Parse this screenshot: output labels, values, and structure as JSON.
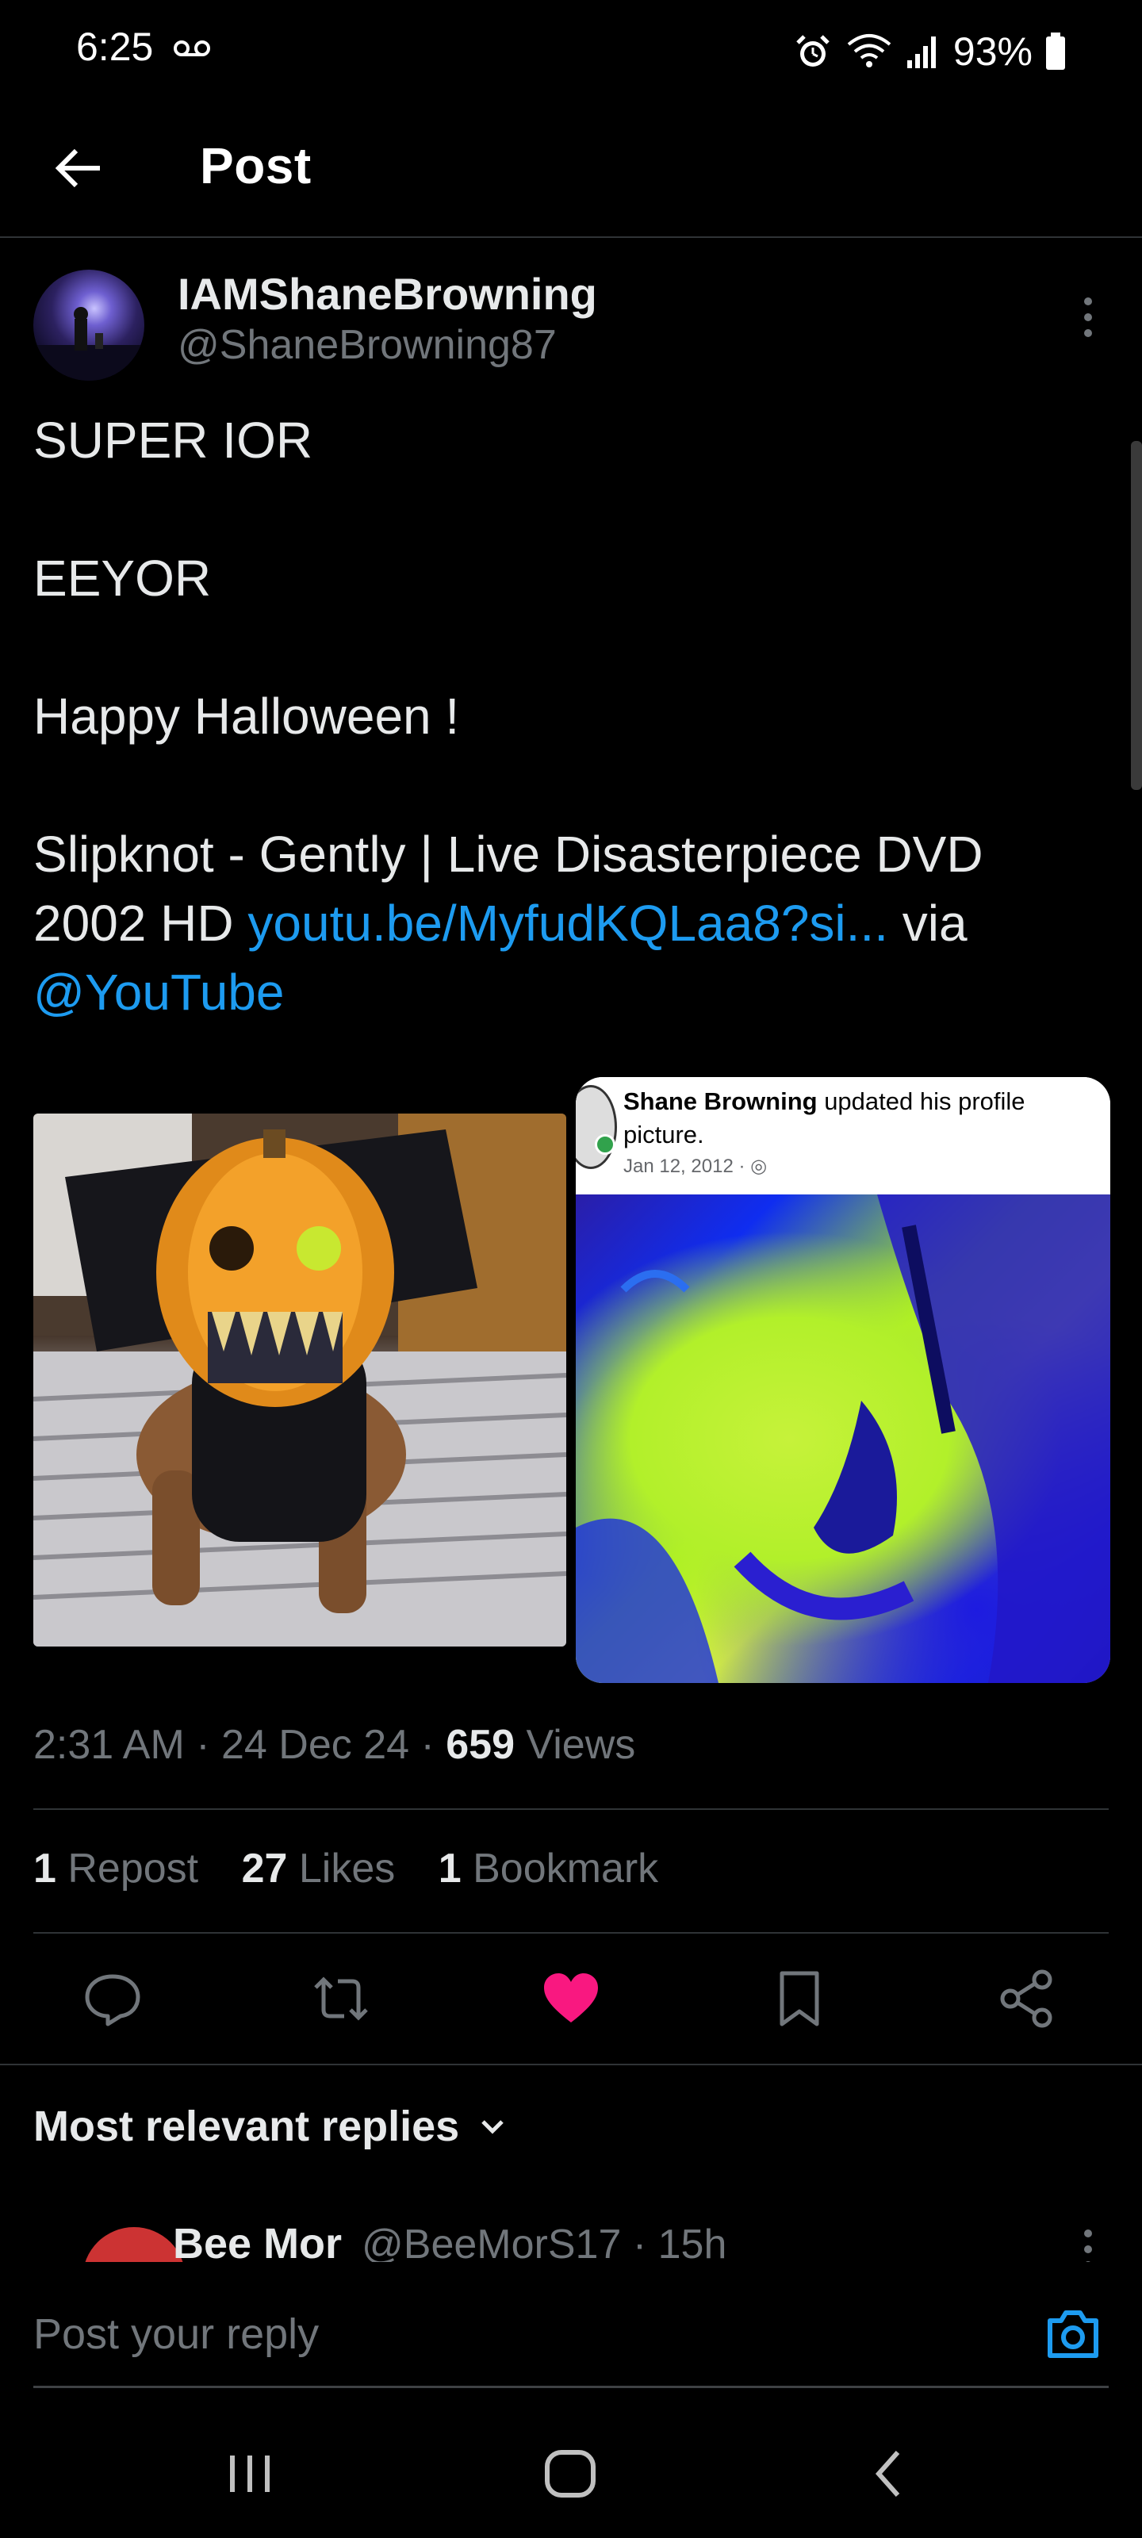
{
  "status_bar": {
    "time": "6:25",
    "battery": "93%"
  },
  "header": {
    "title": "Post"
  },
  "post": {
    "display_name": "IAMShaneBrowning",
    "handle": "@ShaneBrowning87",
    "lines": [
      "SUPER IOR",
      "EEYOR",
      "Happy Halloween !",
      "Slipknot - Gently | Live Disasterpiece DVD 2002 HD "
    ],
    "link_text": "youtu.be/MyfudKQLaa8?si...",
    "via_text": " via ",
    "mention": "@YouTube",
    "media2": {
      "name": "Shane Browning",
      "action": " updated his profile picture.",
      "date": "Jan 12, 2012 · "
    },
    "meta": {
      "time": "2:31 AM · 24 Dec 24 · ",
      "views_count": "659",
      "views_label": " Views"
    },
    "stats": {
      "reposts_count": "1",
      "reposts_label": " Repost",
      "likes_count": "27",
      "likes_label": " Likes",
      "bookmarks_count": "1",
      "bookmarks_label": " Bookmark"
    }
  },
  "replies": {
    "sort_label": "Most relevant replies",
    "first_reply": {
      "name": "Bee Mor",
      "handle": "@BeeMorS17 · 15h"
    }
  },
  "reply_bar": {
    "placeholder": "Post your reply"
  },
  "colors": {
    "accent": "#1d9bf0",
    "like": "#f91880",
    "text_secondary": "#71767b"
  }
}
